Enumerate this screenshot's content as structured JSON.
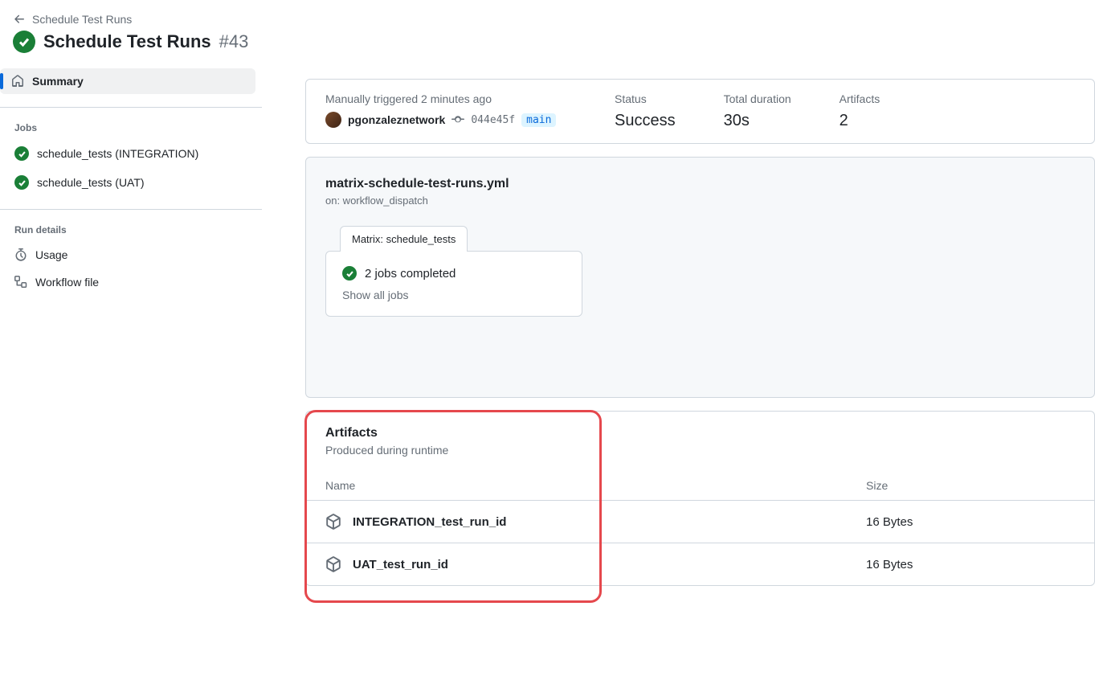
{
  "breadcrumb": {
    "parent_label": "Schedule Test Runs"
  },
  "run": {
    "title": "Schedule Test Runs",
    "number": "#43"
  },
  "sidebar": {
    "summary_label": "Summary",
    "jobs_heading": "Jobs",
    "jobs": [
      {
        "label": "schedule_tests (INTEGRATION)"
      },
      {
        "label": "schedule_tests (UAT)"
      }
    ],
    "details_heading": "Run details",
    "usage_label": "Usage",
    "workflow_file_label": "Workflow file"
  },
  "summary": {
    "trigger_line": "Manually triggered 2 minutes ago",
    "actor": "pgonzaleznetwork",
    "sha": "044e45f",
    "branch": "main",
    "status_label": "Status",
    "status_value": "Success",
    "duration_label": "Total duration",
    "duration_value": "30s",
    "artifacts_label": "Artifacts",
    "artifacts_value": "2"
  },
  "workflow": {
    "file": "matrix-schedule-test-runs.yml",
    "trigger": "on: workflow_dispatch",
    "matrix_label": "Matrix: schedule_tests",
    "matrix_status": "2 jobs completed",
    "show_all": "Show all jobs"
  },
  "artifacts": {
    "title": "Artifacts",
    "subtitle": "Produced during runtime",
    "col_name": "Name",
    "col_size": "Size",
    "rows": [
      {
        "name": "INTEGRATION_test_run_id",
        "size": "16 Bytes"
      },
      {
        "name": "UAT_test_run_id",
        "size": "16 Bytes"
      }
    ]
  }
}
